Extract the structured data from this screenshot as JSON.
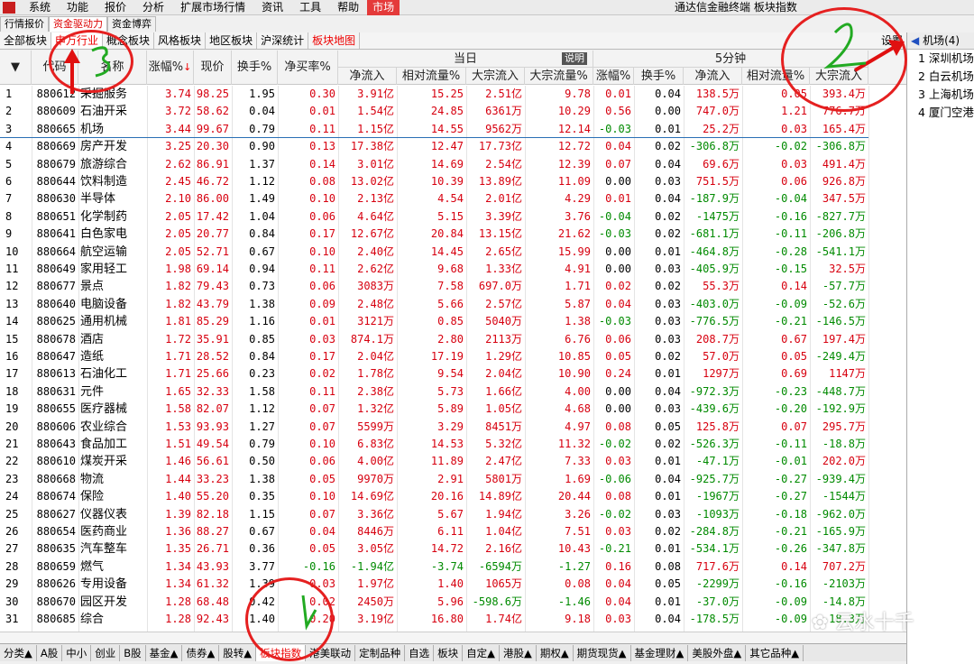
{
  "menubar": {
    "items": [
      "系统",
      "功能",
      "报价",
      "分析",
      "扩展市场行情",
      "资讯",
      "工具",
      "帮助",
      "市场"
    ],
    "title": "通达信金融终端 板块指数"
  },
  "tabs1": [
    "行情报价",
    "资金驱动力",
    "资金博弈"
  ],
  "tabs2": [
    "全部板块",
    "申万行业",
    "概念板块",
    "风格板块",
    "地区板块",
    "沪深统计",
    "板块地图"
  ],
  "settings": "设置",
  "header": {
    "code": "代码",
    "name": "名称",
    "chg": "涨幅%",
    "price": "现价",
    "turnover": "换手%",
    "netbuy": "净买率%",
    "today": "当日",
    "explain": "说明",
    "min5": "5分钟",
    "netflow": "净流入",
    "relflow": "相对流量%",
    "blockflow": "大宗流入",
    "blockpct": "大宗流量%",
    "chg5": "涨幅%",
    "turn5": "换手%",
    "netflow5": "净流入",
    "relflow5": "相对流量%",
    "blockflow5": "大宗流入"
  },
  "rows": [
    [
      "1",
      "880612",
      "采掘服务",
      "3.74",
      "98.25",
      "1.95",
      "0.30",
      "3.91亿",
      "15.25",
      "2.51亿",
      "9.78",
      "0.01",
      "0.04",
      "138.5万",
      "0.05",
      "393.4万"
    ],
    [
      "2",
      "880609",
      "石油开采",
      "3.72",
      "58.62",
      "0.04",
      "0.01",
      "1.54亿",
      "24.85",
      "6361万",
      "10.29",
      "0.56",
      "0.00",
      "747.0万",
      "1.21",
      "776.7万"
    ],
    [
      "3",
      "880665",
      "机场",
      "3.44",
      "99.67",
      "0.79",
      "0.11",
      "1.15亿",
      "14.55",
      "9562万",
      "12.14",
      "-0.03",
      "0.01",
      "25.2万",
      "0.03",
      "165.4万"
    ],
    [
      "4",
      "880669",
      "房产开发",
      "3.25",
      "20.30",
      "0.90",
      "0.13",
      "17.38亿",
      "12.47",
      "17.73亿",
      "12.72",
      "0.04",
      "0.02",
      "-306.8万",
      "-0.02",
      "-306.8万"
    ],
    [
      "5",
      "880679",
      "旅游综合",
      "2.62",
      "86.91",
      "1.37",
      "0.14",
      "3.01亿",
      "14.69",
      "2.54亿",
      "12.39",
      "0.07",
      "0.04",
      "69.6万",
      "0.03",
      "491.4万"
    ],
    [
      "6",
      "880644",
      "饮料制造",
      "2.45",
      "46.72",
      "1.12",
      "0.08",
      "13.02亿",
      "10.39",
      "13.89亿",
      "11.09",
      "0.00",
      "0.03",
      "751.5万",
      "0.06",
      "926.8万"
    ],
    [
      "7",
      "880630",
      "半导体",
      "2.10",
      "86.00",
      "1.49",
      "0.10",
      "2.13亿",
      "4.54",
      "2.01亿",
      "4.29",
      "0.01",
      "0.04",
      "-187.9万",
      "-0.04",
      "347.5万"
    ],
    [
      "8",
      "880651",
      "化学制药",
      "2.05",
      "17.42",
      "1.04",
      "0.06",
      "4.64亿",
      "5.15",
      "3.39亿",
      "3.76",
      "-0.04",
      "0.02",
      "-1475万",
      "-0.16",
      "-827.7万"
    ],
    [
      "9",
      "880641",
      "白色家电",
      "2.05",
      "20.77",
      "0.84",
      "0.17",
      "12.67亿",
      "20.84",
      "13.15亿",
      "21.62",
      "-0.03",
      "0.02",
      "-681.1万",
      "-0.11",
      "-206.8万"
    ],
    [
      "10",
      "880664",
      "航空运输",
      "2.05",
      "52.71",
      "0.67",
      "0.10",
      "2.40亿",
      "14.45",
      "2.65亿",
      "15.99",
      "0.00",
      "0.01",
      "-464.8万",
      "-0.28",
      "-541.1万"
    ],
    [
      "11",
      "880649",
      "家用轻工",
      "1.98",
      "69.14",
      "0.94",
      "0.11",
      "2.62亿",
      "9.68",
      "1.33亿",
      "4.91",
      "0.00",
      "0.03",
      "-405.9万",
      "-0.15",
      "32.5万"
    ],
    [
      "12",
      "880677",
      "景点",
      "1.82",
      "79.43",
      "0.73",
      "0.06",
      "3083万",
      "7.58",
      "697.0万",
      "1.71",
      "0.02",
      "0.02",
      "55.3万",
      "0.14",
      "-57.7万"
    ],
    [
      "13",
      "880640",
      "电脑设备",
      "1.82",
      "43.79",
      "1.38",
      "0.09",
      "2.48亿",
      "5.66",
      "2.57亿",
      "5.87",
      "0.04",
      "0.03",
      "-403.0万",
      "-0.09",
      "-52.6万"
    ],
    [
      "14",
      "880625",
      "通用机械",
      "1.81",
      "85.29",
      "1.16",
      "0.01",
      "3121万",
      "0.85",
      "5040万",
      "1.38",
      "-0.03",
      "0.03",
      "-776.5万",
      "-0.21",
      "-146.5万"
    ],
    [
      "15",
      "880678",
      "酒店",
      "1.72",
      "35.91",
      "0.85",
      "0.03",
      "874.1万",
      "2.80",
      "2113万",
      "6.76",
      "0.06",
      "0.03",
      "208.7万",
      "0.67",
      "197.4万"
    ],
    [
      "16",
      "880647",
      "造纸",
      "1.71",
      "28.52",
      "0.84",
      "0.17",
      "2.04亿",
      "17.19",
      "1.29亿",
      "10.85",
      "0.05",
      "0.02",
      "57.0万",
      "0.05",
      "-249.4万"
    ],
    [
      "17",
      "880613",
      "石油化工",
      "1.71",
      "25.66",
      "0.23",
      "0.02",
      "1.78亿",
      "9.54",
      "2.04亿",
      "10.90",
      "0.24",
      "0.01",
      "1297万",
      "0.69",
      "1147万"
    ],
    [
      "18",
      "880631",
      "元件",
      "1.65",
      "32.33",
      "1.58",
      "0.11",
      "2.38亿",
      "5.73",
      "1.66亿",
      "4.00",
      "0.00",
      "0.04",
      "-972.3万",
      "-0.23",
      "-448.7万"
    ],
    [
      "19",
      "880655",
      "医疗器械",
      "1.58",
      "82.07",
      "1.12",
      "0.07",
      "1.32亿",
      "5.89",
      "1.05亿",
      "4.68",
      "0.00",
      "0.03",
      "-439.6万",
      "-0.20",
      "-192.9万"
    ],
    [
      "20",
      "880606",
      "农业综合",
      "1.53",
      "93.93",
      "1.27",
      "0.07",
      "5599万",
      "3.29",
      "8451万",
      "4.97",
      "0.08",
      "0.05",
      "125.8万",
      "0.07",
      "295.7万"
    ],
    [
      "21",
      "880643",
      "食品加工",
      "1.51",
      "49.54",
      "0.79",
      "0.10",
      "6.83亿",
      "14.53",
      "5.32亿",
      "11.32",
      "-0.02",
      "0.02",
      "-526.3万",
      "-0.11",
      "-18.8万"
    ],
    [
      "22",
      "880610",
      "煤炭开采",
      "1.46",
      "56.61",
      "0.50",
      "0.06",
      "4.00亿",
      "11.89",
      "2.47亿",
      "7.33",
      "0.03",
      "0.01",
      "-47.1万",
      "-0.01",
      "202.0万"
    ],
    [
      "23",
      "880668",
      "物流",
      "1.44",
      "33.23",
      "1.38",
      "0.05",
      "9970万",
      "2.91",
      "5801万",
      "1.69",
      "-0.06",
      "0.04",
      "-925.7万",
      "-0.27",
      "-939.4万"
    ],
    [
      "24",
      "880674",
      "保险",
      "1.40",
      "55.20",
      "0.35",
      "0.10",
      "14.69亿",
      "20.16",
      "14.89亿",
      "20.44",
      "0.08",
      "0.01",
      "-1967万",
      "-0.27",
      "-1544万"
    ],
    [
      "25",
      "880627",
      "仪器仪表",
      "1.39",
      "82.18",
      "1.15",
      "0.07",
      "3.36亿",
      "5.67",
      "1.94亿",
      "3.26",
      "-0.02",
      "0.03",
      "-1093万",
      "-0.18",
      "-962.0万"
    ],
    [
      "26",
      "880654",
      "医药商业",
      "1.36",
      "88.27",
      "0.67",
      "0.04",
      "8446万",
      "6.11",
      "1.04亿",
      "7.51",
      "0.03",
      "0.02",
      "-284.8万",
      "-0.21",
      "-165.9万"
    ],
    [
      "27",
      "880635",
      "汽车整车",
      "1.35",
      "26.71",
      "0.36",
      "0.05",
      "3.05亿",
      "14.72",
      "2.16亿",
      "10.43",
      "-0.21",
      "0.01",
      "-534.1万",
      "-0.26",
      "-347.8万"
    ],
    [
      "28",
      "880659",
      "燃气",
      "1.34",
      "43.93",
      "3.77",
      "-0.16",
      "-1.94亿",
      "-3.74",
      "-6594万",
      "-1.27",
      "0.16",
      "0.08",
      "717.6万",
      "0.14",
      "707.2万"
    ],
    [
      "29",
      "880626",
      "专用设备",
      "1.34",
      "61.32",
      "1.39",
      "0.03",
      "1.97亿",
      "1.40",
      "1065万",
      "0.08",
      "0.04",
      "0.05",
      "-2299万",
      "-0.16",
      "-2103万"
    ],
    [
      "30",
      "880670",
      "园区开发",
      "1.28",
      "68.48",
      "0.42",
      "0.02",
      "2450万",
      "5.96",
      "-598.6万",
      "-1.46",
      "0.04",
      "0.01",
      "-37.0万",
      "-0.09",
      "-14.8万"
    ],
    [
      "31",
      "880685",
      "综合",
      "1.28",
      "92.43",
      "1.40",
      "0.20",
      "3.19亿",
      "16.80",
      "1.74亿",
      "9.18",
      "0.03",
      "0.04",
      "-178.5万",
      "-0.09",
      "-18.3万"
    ]
  ],
  "right": {
    "header": "机场(4)",
    "items": [
      "1 深圳机场",
      "2 白云机场",
      "3 上海机场",
      "4 厦门空港"
    ]
  },
  "bottom": [
    "分类▲",
    "A股",
    "中小",
    "创业",
    "B股",
    "基金▲",
    "债券▲",
    "股转▲",
    "板块指数",
    "港美联动",
    "定制品种",
    "自选",
    "板块",
    "自定▲",
    "港股▲",
    "期权▲",
    "期货现货▲",
    "基金理财▲",
    "美股外盘▲",
    "其它品种▲"
  ],
  "watermark": "云水十千",
  "colors": {
    "up": "#d7000f",
    "down": "#008a00",
    "accent": "#e00000"
  }
}
